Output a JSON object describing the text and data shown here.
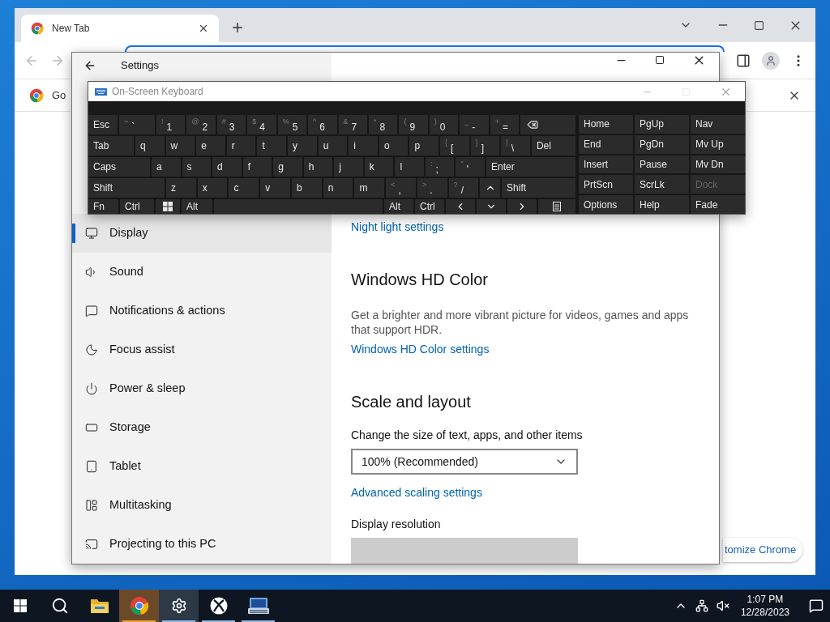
{
  "chrome": {
    "tabs": [
      {
        "title": "New Tab",
        "selected": true
      }
    ],
    "bookmark": "Go",
    "customize_button": "tomize Chrome"
  },
  "settings": {
    "title": "Settings",
    "sidebar": [
      {
        "kind": "display",
        "label": "Display",
        "selected": true
      },
      {
        "kind": "sound",
        "label": "Sound",
        "selected": false
      },
      {
        "kind": "notifications",
        "label": "Notifications & actions",
        "selected": false
      },
      {
        "kind": "focus",
        "label": "Focus assist",
        "selected": false
      },
      {
        "kind": "power",
        "label": "Power & sleep",
        "selected": false
      },
      {
        "kind": "storage",
        "label": "Storage",
        "selected": false
      },
      {
        "kind": "tablet",
        "label": "Tablet",
        "selected": false
      },
      {
        "kind": "multitasking",
        "label": "Multitasking",
        "selected": false
      },
      {
        "kind": "projecting",
        "label": "Projecting to this PC",
        "selected": false
      }
    ],
    "content": [
      {
        "kind": "link",
        "text": "Night light settings"
      },
      {
        "kind": "heading",
        "text": "Windows HD Color"
      },
      {
        "kind": "paragraph",
        "text": "Get a brighter and more vibrant picture for videos, games and apps that support HDR."
      },
      {
        "kind": "link",
        "text": "Windows HD Color settings"
      },
      {
        "kind": "heading",
        "text": "Scale and layout"
      },
      {
        "kind": "label",
        "text": "Change the size of text, apps, and other items"
      },
      {
        "kind": "dropdown",
        "value": "100% (Recommended)",
        "disabled": false
      },
      {
        "kind": "link",
        "text": "Advanced scaling settings"
      },
      {
        "kind": "label",
        "text": "Display resolution"
      },
      {
        "kind": "dropdown",
        "disabled": true
      }
    ]
  },
  "keyboard": {
    "title": "On-Screen Keyboard",
    "rows": [
      [
        {
          "kind": "text",
          "label": "Esc"
        },
        {
          "kind": "text",
          "label": "`",
          "shift": "~"
        },
        {
          "kind": "text",
          "label": "1",
          "shift": "!"
        },
        {
          "kind": "text",
          "label": "2",
          "shift": "@"
        },
        {
          "kind": "text",
          "label": "3",
          "shift": "#"
        },
        {
          "kind": "text",
          "label": "4",
          "shift": "$"
        },
        {
          "kind": "text",
          "label": "5",
          "shift": "%"
        },
        {
          "kind": "text",
          "label": "6",
          "shift": "^"
        },
        {
          "kind": "text",
          "label": "7",
          "shift": "&"
        },
        {
          "kind": "text",
          "label": "8",
          "shift": "*"
        },
        {
          "kind": "text",
          "label": "9",
          "shift": "("
        },
        {
          "kind": "text",
          "label": "0",
          "shift": ")"
        },
        {
          "kind": "text",
          "label": "-",
          "shift": "_"
        },
        {
          "kind": "text",
          "label": "=",
          "shift": "+"
        },
        {
          "kind": "backspace"
        }
      ],
      [
        {
          "kind": "text",
          "label": "Tab"
        },
        {
          "kind": "text",
          "label": "q"
        },
        {
          "kind": "text",
          "label": "w"
        },
        {
          "kind": "text",
          "label": "e"
        },
        {
          "kind": "text",
          "label": "r"
        },
        {
          "kind": "text",
          "label": "t"
        },
        {
          "kind": "text",
          "label": "y"
        },
        {
          "kind": "text",
          "label": "u"
        },
        {
          "kind": "text",
          "label": "i"
        },
        {
          "kind": "text",
          "label": "o"
        },
        {
          "kind": "text",
          "label": "p"
        },
        {
          "kind": "text",
          "label": "[",
          "shift": "{"
        },
        {
          "kind": "text",
          "label": "]",
          "shift": "}"
        },
        {
          "kind": "text",
          "label": "\\",
          "shift": "|"
        },
        {
          "kind": "text",
          "label": "Del"
        }
      ],
      [
        {
          "kind": "text",
          "label": "Caps"
        },
        {
          "kind": "text",
          "label": "a"
        },
        {
          "kind": "text",
          "label": "s"
        },
        {
          "kind": "text",
          "label": "d"
        },
        {
          "kind": "text",
          "label": "f"
        },
        {
          "kind": "text",
          "label": "g"
        },
        {
          "kind": "text",
          "label": "h"
        },
        {
          "kind": "text",
          "label": "j"
        },
        {
          "kind": "text",
          "label": "k"
        },
        {
          "kind": "text",
          "label": "l"
        },
        {
          "kind": "text",
          "label": ";",
          "shift": ":"
        },
        {
          "kind": "text",
          "label": "'",
          "shift": "\""
        },
        {
          "kind": "text",
          "label": "Enter"
        }
      ],
      [
        {
          "kind": "text",
          "label": "Shift"
        },
        {
          "kind": "text",
          "label": "z"
        },
        {
          "kind": "text",
          "label": "x"
        },
        {
          "kind": "text",
          "label": "c"
        },
        {
          "kind": "text",
          "label": "v"
        },
        {
          "kind": "text",
          "label": "b"
        },
        {
          "kind": "text",
          "label": "n"
        },
        {
          "kind": "text",
          "label": "m"
        },
        {
          "kind": "text",
          "label": ",",
          "shift": "<"
        },
        {
          "kind": "text",
          "label": ".",
          "shift": ">"
        },
        {
          "kind": "text",
          "label": "/",
          "shift": "?"
        },
        {
          "kind": "up"
        },
        {
          "kind": "text",
          "label": "Shift"
        }
      ],
      [
        {
          "kind": "text",
          "label": "Fn"
        },
        {
          "kind": "text",
          "label": "Ctrl"
        },
        {
          "kind": "windows"
        },
        {
          "kind": "text",
          "label": "Alt"
        },
        {
          "kind": "space"
        },
        {
          "kind": "text",
          "label": "Alt"
        },
        {
          "kind": "text",
          "label": "Ctrl"
        },
        {
          "kind": "left"
        },
        {
          "kind": "down"
        },
        {
          "kind": "right"
        },
        {
          "kind": "menu"
        }
      ]
    ],
    "nav_keys": [
      {
        "label": "Home",
        "disabled": false
      },
      {
        "label": "PgUp",
        "disabled": false
      },
      {
        "label": "Nav",
        "disabled": false
      },
      {
        "label": "End",
        "disabled": false
      },
      {
        "label": "PgDn",
        "disabled": false
      },
      {
        "label": "Mv Up",
        "disabled": false
      },
      {
        "label": "Insert",
        "disabled": false
      },
      {
        "label": "Pause",
        "disabled": false
      },
      {
        "label": "Mv Dn",
        "disabled": false
      },
      {
        "label": "PrtScn",
        "disabled": false
      },
      {
        "label": "ScrLk",
        "disabled": false
      },
      {
        "label": "Dock",
        "disabled": true
      },
      {
        "label": "Options",
        "disabled": false
      },
      {
        "label": "Help",
        "disabled": false
      },
      {
        "label": "Fade",
        "disabled": false
      }
    ]
  },
  "taskbar": {
    "apps": [
      {
        "kind": "start",
        "running": false,
        "flashing": false,
        "focused": false
      },
      {
        "kind": "search",
        "running": false,
        "flashing": false,
        "focused": false
      },
      {
        "kind": "explorer",
        "running": false,
        "flashing": false,
        "focused": false
      },
      {
        "kind": "chrome",
        "running": true,
        "flashing": true,
        "focused": false
      },
      {
        "kind": "settings",
        "running": true,
        "flashing": false,
        "focused": true
      },
      {
        "kind": "xbox",
        "running": true,
        "flashing": false,
        "focused": false
      },
      {
        "kind": "keyboard",
        "running": true,
        "flashing": false,
        "focused": false
      }
    ],
    "time": "1:07 PM",
    "date": "12/28/2023"
  }
}
